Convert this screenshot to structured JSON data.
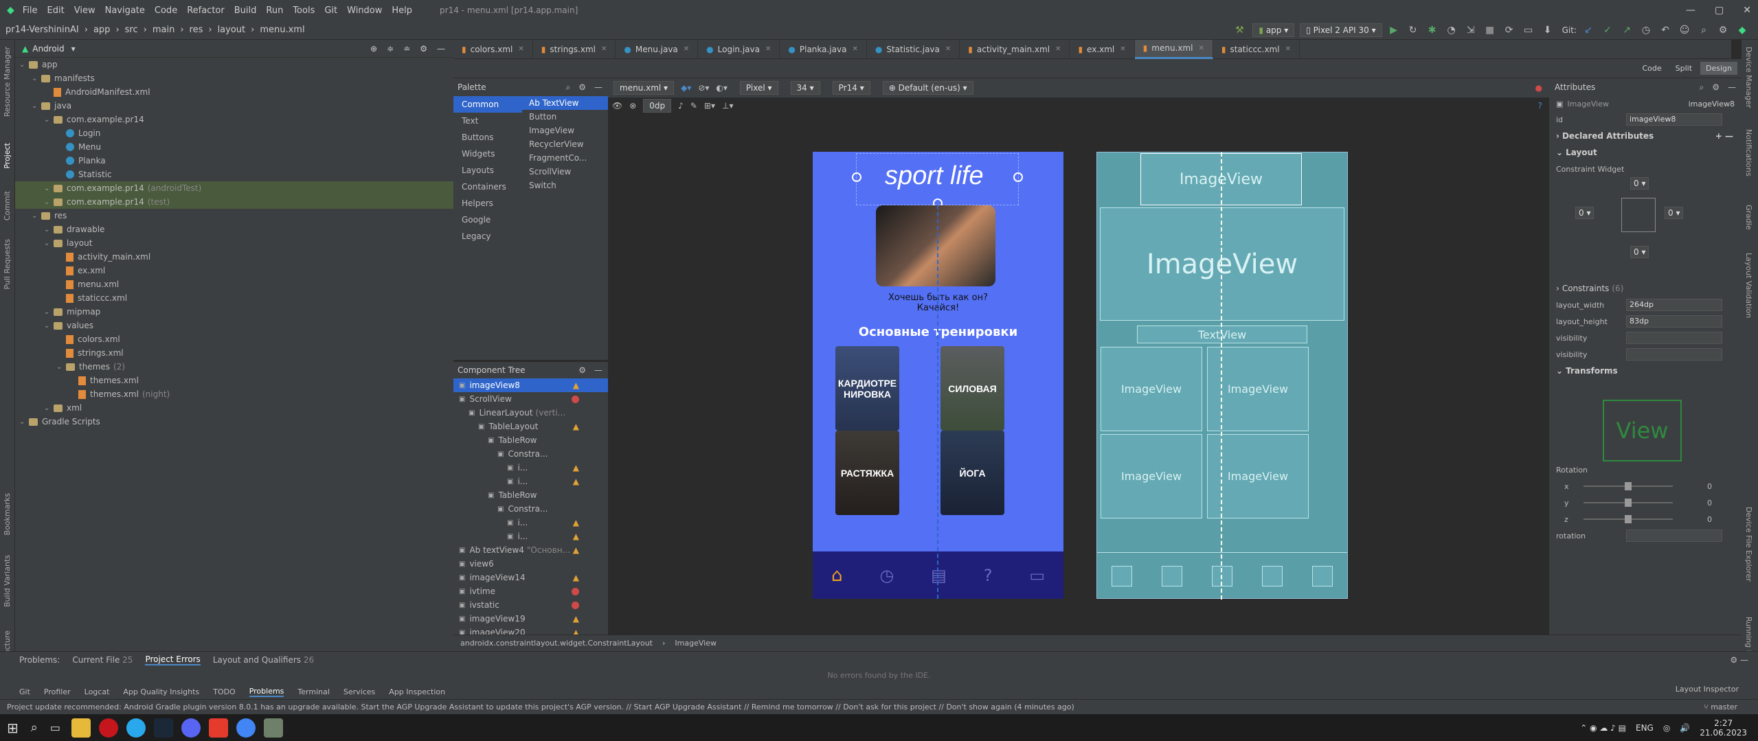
{
  "menu": [
    "File",
    "Edit",
    "View",
    "Navigate",
    "Code",
    "Refactor",
    "Build",
    "Run",
    "Tools",
    "Git",
    "Window",
    "Help"
  ],
  "window_title": "pr14 - menu.xml [pr14.app.main]",
  "breadcrumb": [
    "pr14-VershininAI",
    "app",
    "src",
    "main",
    "res",
    "layout",
    "menu.xml"
  ],
  "run_config": "app",
  "device": "Pixel 2 API 30",
  "git_label": "Git:",
  "project_view": "Android",
  "tree": [
    {
      "label": "app",
      "d": 0,
      "kind": "folder"
    },
    {
      "label": "manifests",
      "d": 1,
      "kind": "folder"
    },
    {
      "label": "AndroidManifest.xml",
      "d": 2,
      "kind": "xml"
    },
    {
      "label": "java",
      "d": 1,
      "kind": "folder"
    },
    {
      "label": "com.example.pr14",
      "d": 2,
      "kind": "folder"
    },
    {
      "label": "Login",
      "d": 3,
      "kind": "class"
    },
    {
      "label": "Menu",
      "d": 3,
      "kind": "class"
    },
    {
      "label": "Planka",
      "d": 3,
      "kind": "class"
    },
    {
      "label": "Statistic",
      "d": 3,
      "kind": "class"
    },
    {
      "label": "com.example.pr14",
      "suffix": "(androidTest)",
      "d": 2,
      "kind": "folder",
      "hl": true
    },
    {
      "label": "com.example.pr14",
      "suffix": "(test)",
      "d": 2,
      "kind": "folder",
      "hl": true
    },
    {
      "label": "res",
      "d": 1,
      "kind": "folder"
    },
    {
      "label": "drawable",
      "d": 2,
      "kind": "folder"
    },
    {
      "label": "layout",
      "d": 2,
      "kind": "folder"
    },
    {
      "label": "activity_main.xml",
      "d": 3,
      "kind": "xml"
    },
    {
      "label": "ex.xml",
      "d": 3,
      "kind": "xml"
    },
    {
      "label": "menu.xml",
      "d": 3,
      "kind": "xml"
    },
    {
      "label": "staticcc.xml",
      "d": 3,
      "kind": "xml"
    },
    {
      "label": "mipmap",
      "d": 2,
      "kind": "folder"
    },
    {
      "label": "values",
      "d": 2,
      "kind": "folder"
    },
    {
      "label": "colors.xml",
      "d": 3,
      "kind": "xml"
    },
    {
      "label": "strings.xml",
      "d": 3,
      "kind": "xml"
    },
    {
      "label": "themes",
      "suffix": "(2)",
      "d": 3,
      "kind": "folder"
    },
    {
      "label": "themes.xml",
      "d": 4,
      "kind": "xml"
    },
    {
      "label": "themes.xml",
      "suffix": "(night)",
      "d": 4,
      "kind": "xml"
    },
    {
      "label": "xml",
      "d": 2,
      "kind": "folder"
    },
    {
      "label": "Gradle Scripts",
      "d": 0,
      "kind": "gradle"
    }
  ],
  "editor_tabs": [
    "colors.xml",
    "strings.xml",
    "Menu.java",
    "Login.java",
    "Planka.java",
    "Statistic.java",
    "activity_main.xml",
    "ex.xml",
    "menu.xml",
    "staticcc.xml"
  ],
  "active_tab": 8,
  "view_modes": [
    "Code",
    "Split",
    "Design"
  ],
  "palette": {
    "title": "Palette",
    "categories": [
      "Common",
      "Text",
      "Buttons",
      "Widgets",
      "Layouts",
      "Containers",
      "Helpers",
      "Google",
      "Legacy"
    ],
    "items": [
      "Ab TextView",
      "Button",
      "ImageView",
      "RecyclerView",
      "FragmentCo...",
      "ScrollView",
      "Switch"
    ]
  },
  "design_toolbar": {
    "file": "menu.xml",
    "device": "Pixel",
    "api": "34",
    "theme": "Pr14",
    "locale": "Default (en-us)",
    "margin": "0dp"
  },
  "component_tree": {
    "title": "Component Tree",
    "items": [
      {
        "label": "imageView8",
        "d": 0,
        "st": "warn",
        "sel": true
      },
      {
        "label": "ScrollView",
        "d": 0,
        "st": "err"
      },
      {
        "label": "LinearLayout",
        "suffix": "(verti...",
        "d": 1,
        "st": ""
      },
      {
        "label": "TableLayout",
        "d": 2,
        "st": "warn"
      },
      {
        "label": "TableRow",
        "d": 3,
        "st": ""
      },
      {
        "label": "Constra...",
        "d": 4,
        "st": ""
      },
      {
        "label": "i...",
        "d": 5,
        "st": "warn"
      },
      {
        "label": "i...",
        "d": 5,
        "st": "warn"
      },
      {
        "label": "TableRow",
        "d": 3,
        "st": ""
      },
      {
        "label": "Constra...",
        "d": 4,
        "st": ""
      },
      {
        "label": "i...",
        "d": 5,
        "st": "warn"
      },
      {
        "label": "i...",
        "d": 5,
        "st": "warn"
      },
      {
        "label": "Ab textView4",
        "suffix": "\"Основн...",
        "d": 0,
        "st": "warn"
      },
      {
        "label": "view6",
        "d": 0,
        "st": ""
      },
      {
        "label": "imageView14",
        "d": 0,
        "st": "warn"
      },
      {
        "label": "ivtime",
        "d": 0,
        "st": "err"
      },
      {
        "label": "ivstatic",
        "d": 0,
        "st": "err"
      },
      {
        "label": "imageView19",
        "d": 0,
        "st": "warn"
      },
      {
        "label": "imageView20",
        "d": 0,
        "st": "warn"
      }
    ]
  },
  "phone": {
    "logo": "sport life",
    "tagline1": "Хочешь быть как он?",
    "tagline2": "Качайся!",
    "heading": "Основные тренировки",
    "cards": [
      "КАРДИОТРЕНИРОВКА",
      "СИЛОВАЯ",
      "РАСТЯЖКА",
      "ЙОГА"
    ]
  },
  "blueprint": {
    "image": "ImageView",
    "text": "TextView"
  },
  "attributes": {
    "title": "Attributes",
    "type": "ImageView",
    "name": "imageView8",
    "id_label": "id",
    "id_value": "imageView8",
    "declared": "Declared Attributes",
    "layout": "Layout",
    "constraint_widget": "Constraint Widget",
    "margins": [
      "0",
      "0",
      "0",
      "0"
    ],
    "constraints": "Constraints",
    "constraints_count": "(6)",
    "rows": [
      {
        "k": "layout_width",
        "v": "264dp"
      },
      {
        "k": "layout_height",
        "v": "83dp"
      },
      {
        "k": "visibility",
        "v": ""
      },
      {
        "k": "visibility",
        "v": ""
      }
    ],
    "transforms": "Transforms",
    "view_preview": "View",
    "rotation": "Rotation",
    "axes": [
      "x",
      "y",
      "z"
    ],
    "axis_values": [
      "0",
      "0",
      "0"
    ],
    "rotation_label": "rotation"
  },
  "status_path": [
    "androidx.constraintlayout.widget.ConstraintLayout",
    "ImageView"
  ],
  "problems": {
    "label": "Problems:",
    "tabs": [
      {
        "label": "Current File",
        "count": "25"
      },
      {
        "label": "Project Errors",
        "count": ""
      },
      {
        "label": "Layout and Qualifiers",
        "count": "26"
      }
    ],
    "empty": "No errors found by the IDE."
  },
  "tool_tabs": [
    "Git",
    "Profiler",
    "Logcat",
    "App Quality Insights",
    "TODO",
    "Problems",
    "Terminal",
    "Services",
    "App Inspection"
  ],
  "layout_inspector": "Layout Inspector",
  "status_msg": "Project update recommended: Android Gradle plugin version 8.0.1 has an upgrade available.  Start the AGP Upgrade Assistant to update this project's AGP version. // Start AGP Upgrade Assistant // Remind me tomorrow // Don't ask for this project // Don't show again (4 minutes ago)",
  "branch": "master",
  "clock_time": "2:27",
  "clock_date": "21.06.2023",
  "lang": "ENG",
  "left_vtabs": [
    "Resource Manager",
    "Project",
    "Commit",
    "Pull Requests",
    "Bookmarks",
    "Build Variants",
    "Structure"
  ],
  "right_vtabs": [
    "Device Manager",
    "Notifications",
    "Gradle",
    "Layout Validation",
    "Device File Explorer",
    "Running Devices"
  ],
  "colors": {
    "phone_bg": "#5470f5",
    "phone_nav": "#1f1f7a",
    "blueprint": "#5a9fa8",
    "accent": "#2f65ca"
  }
}
